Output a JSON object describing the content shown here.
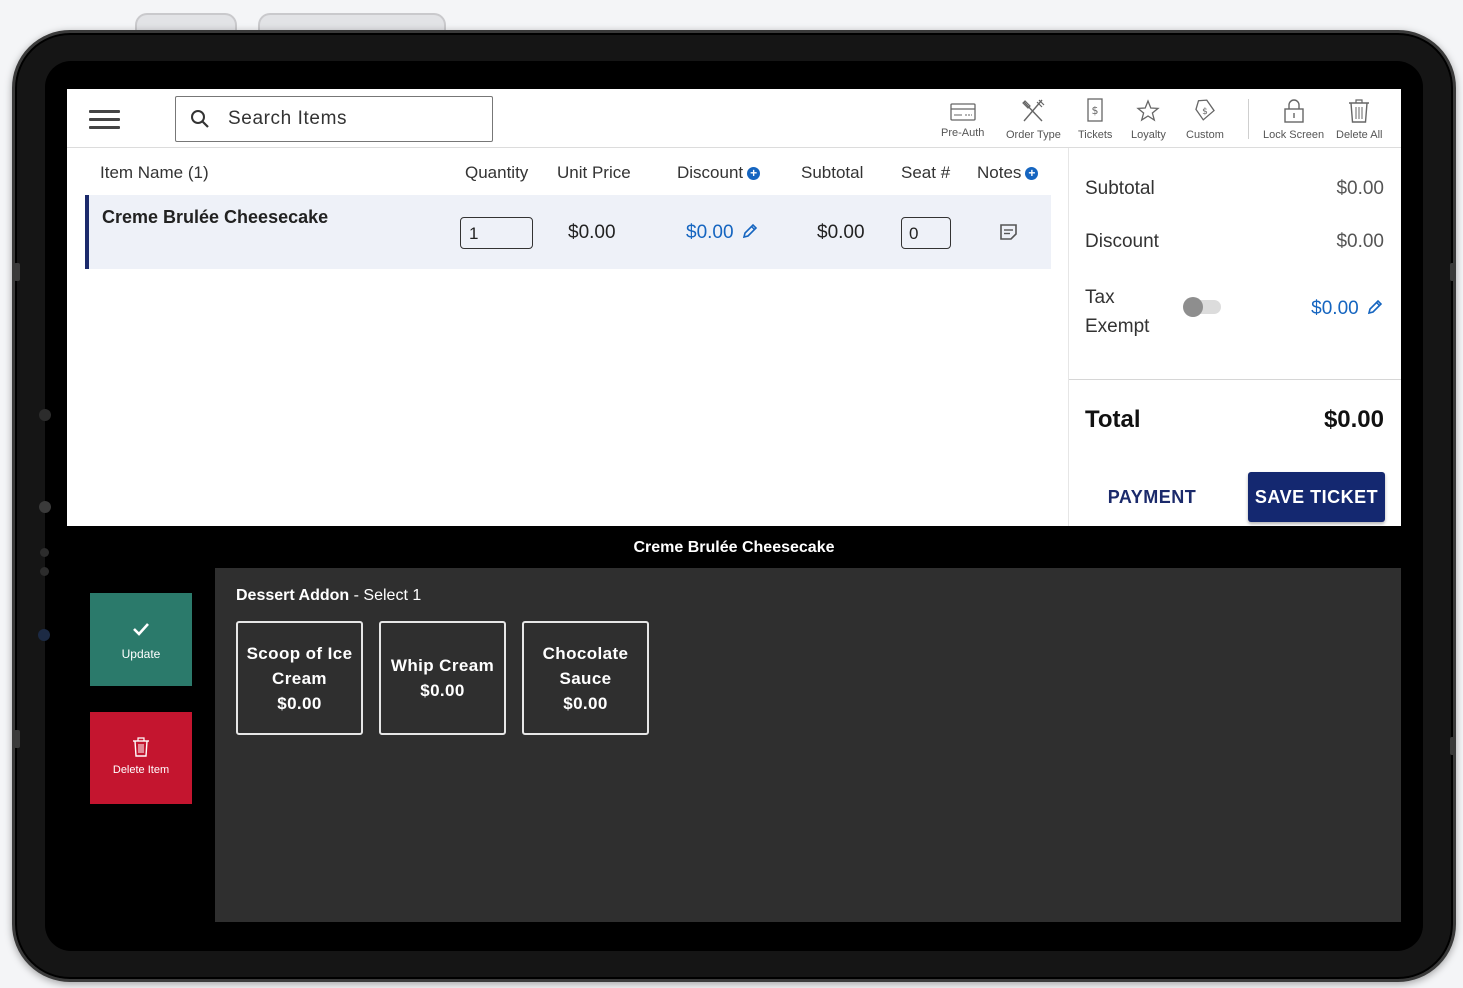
{
  "search": {
    "placeholder": "Search Items"
  },
  "toolbar": {
    "pre_auth": "Pre-Auth",
    "order_type": "Order Type",
    "tickets": "Tickets",
    "loyalty": "Loyalty",
    "custom": "Custom",
    "lock_screen": "Lock Screen",
    "delete_all": "Delete All"
  },
  "table": {
    "headers": {
      "item_name": "Item Name (1)",
      "quantity": "Quantity",
      "unit_price": "Unit Price",
      "discount": "Discount",
      "subtotal": "Subtotal",
      "seat": "Seat #",
      "notes": "Notes"
    },
    "rows": [
      {
        "name": "Creme Brulée Cheesecake",
        "quantity": "1",
        "unit_price": "$0.00",
        "discount": "$0.00",
        "subtotal": "$0.00",
        "seat": "0"
      }
    ]
  },
  "summary": {
    "subtotal_label": "Subtotal",
    "subtotal_value": "$0.00",
    "discount_label": "Discount",
    "discount_value": "$0.00",
    "tax_label_1": "Tax",
    "tax_label_2": "Exempt",
    "tax_value": "$0.00",
    "tax_exempt_enabled": false,
    "total_label": "Total",
    "total_value": "$0.00",
    "payment_label": "PAYMENT",
    "save_label": "SAVE TICKET"
  },
  "modifier": {
    "title": "Creme Brulée Cheesecake",
    "update_label": "Update",
    "delete_label": "Delete Item",
    "group_name": "Dessert Addon",
    "group_rule": " - Select 1",
    "addons": [
      {
        "line1": "Scoop of Ice",
        "line2": "Cream",
        "price": "$0.00"
      },
      {
        "line1": "Whip Cream",
        "line2": "",
        "price": "$0.00"
      },
      {
        "line1": "Chocolate",
        "line2": "Sauce",
        "price": "$0.00"
      }
    ]
  },
  "colors": {
    "brand_navy": "#142870",
    "link_blue": "#1565c0",
    "update_green": "#2b7a6b",
    "delete_red": "#c4152f"
  },
  "icons": [
    "hamburger-icon",
    "search-icon",
    "card-icon",
    "utensils-icon",
    "ticket-icon",
    "star-icon",
    "tag-icon",
    "lock-icon",
    "trash-icon",
    "plus-circle-icon",
    "pencil-icon",
    "note-icon",
    "check-icon"
  ]
}
